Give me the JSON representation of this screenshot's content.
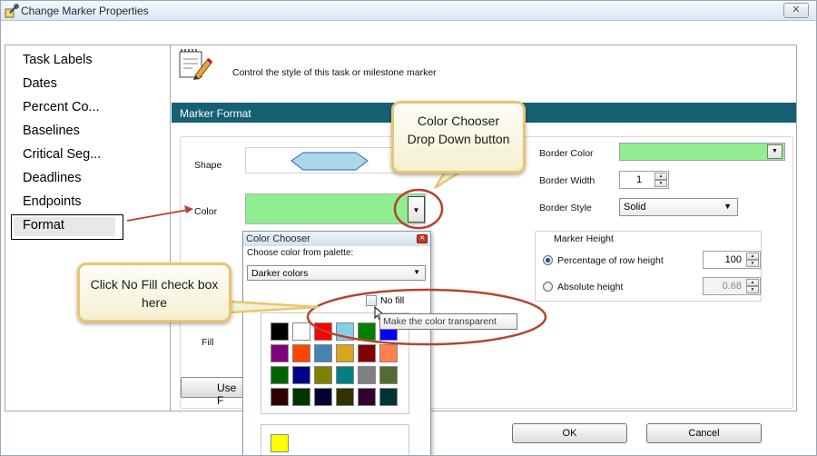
{
  "window": {
    "title": "Change Marker Properties",
    "close_glyph": "✕"
  },
  "sidebar": {
    "items": [
      {
        "label": "Task Labels"
      },
      {
        "label": "Dates"
      },
      {
        "label": "Percent Co..."
      },
      {
        "label": "Baselines"
      },
      {
        "label": "Critical Seg..."
      },
      {
        "label": "Deadlines"
      },
      {
        "label": "Endpoints"
      },
      {
        "label": "Format",
        "selected": true
      }
    ]
  },
  "header": {
    "description": "Control the style of this task or milestone marker",
    "icon": "notepad-pencil-icon"
  },
  "section": {
    "title": "Marker Format"
  },
  "fields": {
    "shape_label": "Shape",
    "color_label": "Color",
    "fill_label": "Fill",
    "use_button_label": "Use F",
    "color_value_hex": "#90EE90",
    "shape_fill_hex": "#ADD8E6"
  },
  "border": {
    "color_label": "Border Color",
    "color_hex": "#90EE90",
    "width_label": "Border Width",
    "width_value": "1",
    "style_label": "Border Style",
    "style_value": "Solid"
  },
  "marker_height": {
    "title": "Marker Height",
    "option_percentage": "Percentage of row height",
    "percentage_value": "100",
    "option_absolute": "Absolute height",
    "absolute_value": "0.68",
    "selected": "percentage"
  },
  "color_chooser": {
    "title": "Color Chooser",
    "subtitle": "Choose color from palette:",
    "palette_value": "Darker colors",
    "no_fill_label": "No fill",
    "tooltip": "Make the color transparent",
    "swatches": [
      "#000000",
      "#FFFFFF",
      "#FF0000",
      "#87CEEB",
      "#008000",
      "#0000FF",
      "#800080",
      "#FF4500",
      "#4682B4",
      "#DAA520",
      "#800000",
      "#FF7F50",
      "#006400",
      "#00008B",
      "#808000",
      "#008080",
      "#808080",
      "#556B2F",
      "#2F0000",
      "#003300",
      "#000033",
      "#333300",
      "#330033",
      "#003333"
    ],
    "custom_swatch": "#FFFF00"
  },
  "footer": {
    "ok_label": "OK",
    "cancel_label": "Cancel"
  },
  "callouts": {
    "color_chooser": "Color Chooser Drop Down button",
    "no_fill": "Click No Fill check box here"
  },
  "colors": {
    "section_bar": "#156173",
    "callout_border": "#E8C66E",
    "annotation_red": "#B5432F"
  }
}
